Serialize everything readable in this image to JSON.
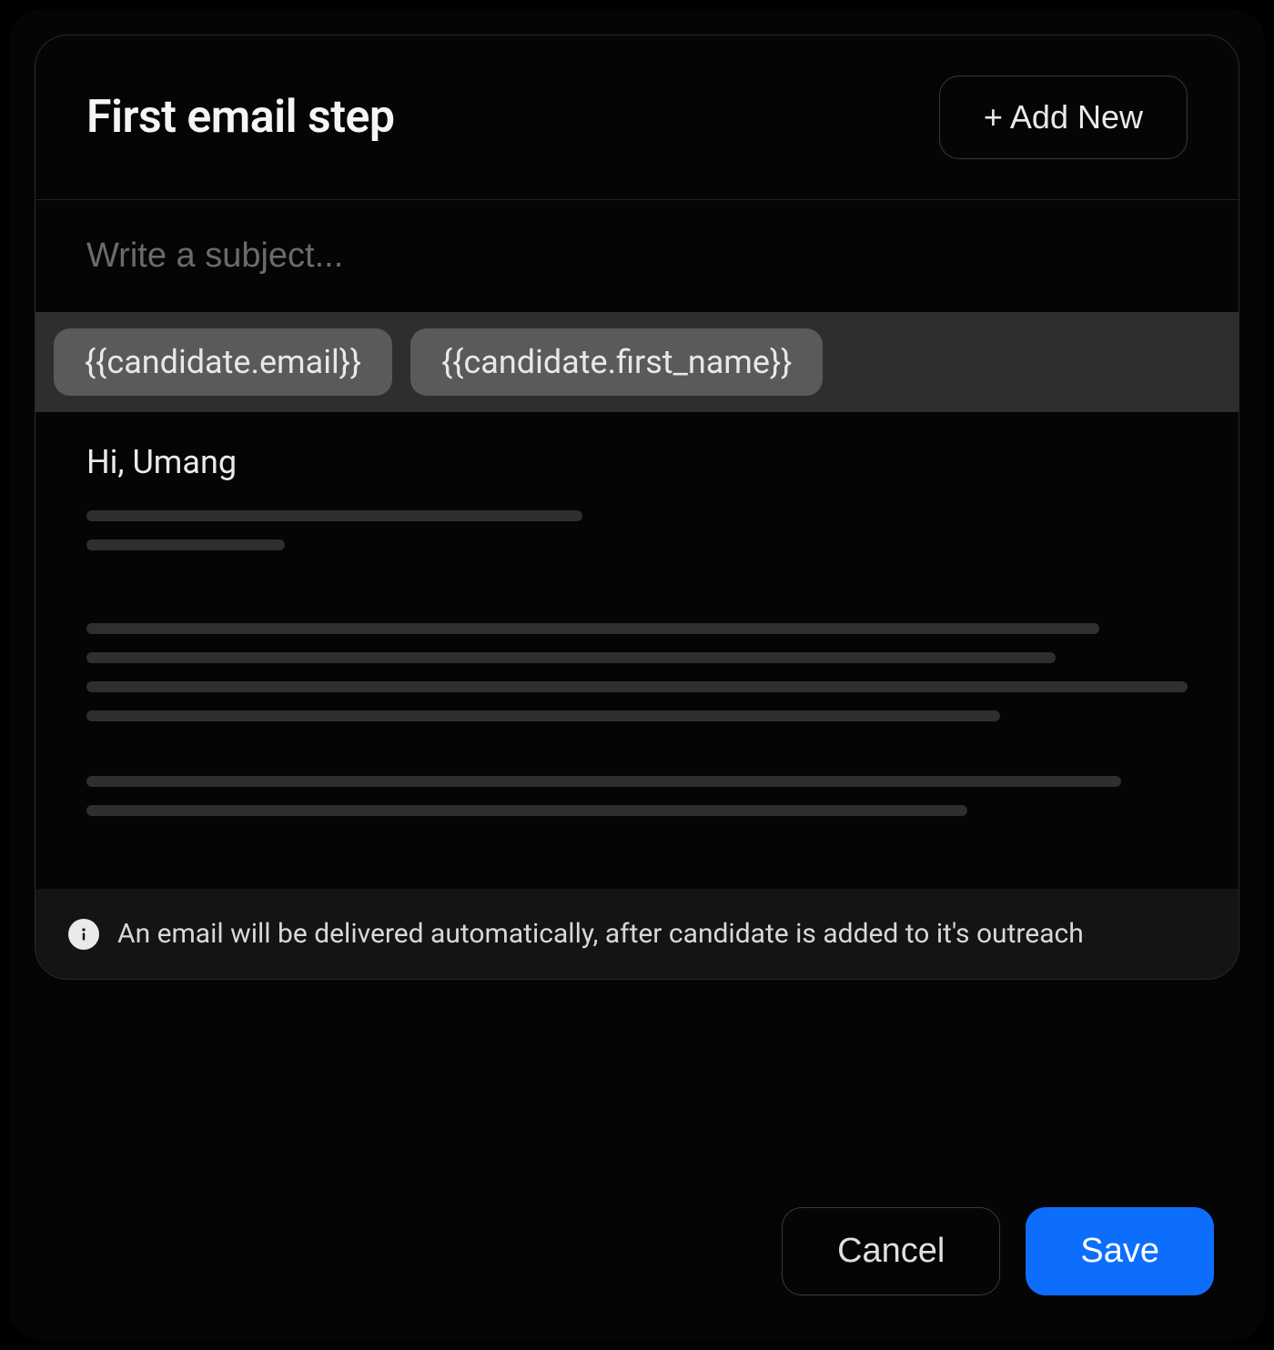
{
  "header": {
    "title": "First email step",
    "add_new_label": "+ Add New"
  },
  "subject": {
    "placeholder": "Write a subject...",
    "value": ""
  },
  "tokens": {
    "items": [
      "{{candidate.email}}",
      "{{candidate.first_name}}"
    ]
  },
  "body": {
    "greeting": "Hi, Umang"
  },
  "info": {
    "text": "An email will be delivered automatically, after candidate is added to it's outreach"
  },
  "actions": {
    "cancel_label": "Cancel",
    "save_label": "Save"
  },
  "colors": {
    "accent": "#0d6efd"
  }
}
